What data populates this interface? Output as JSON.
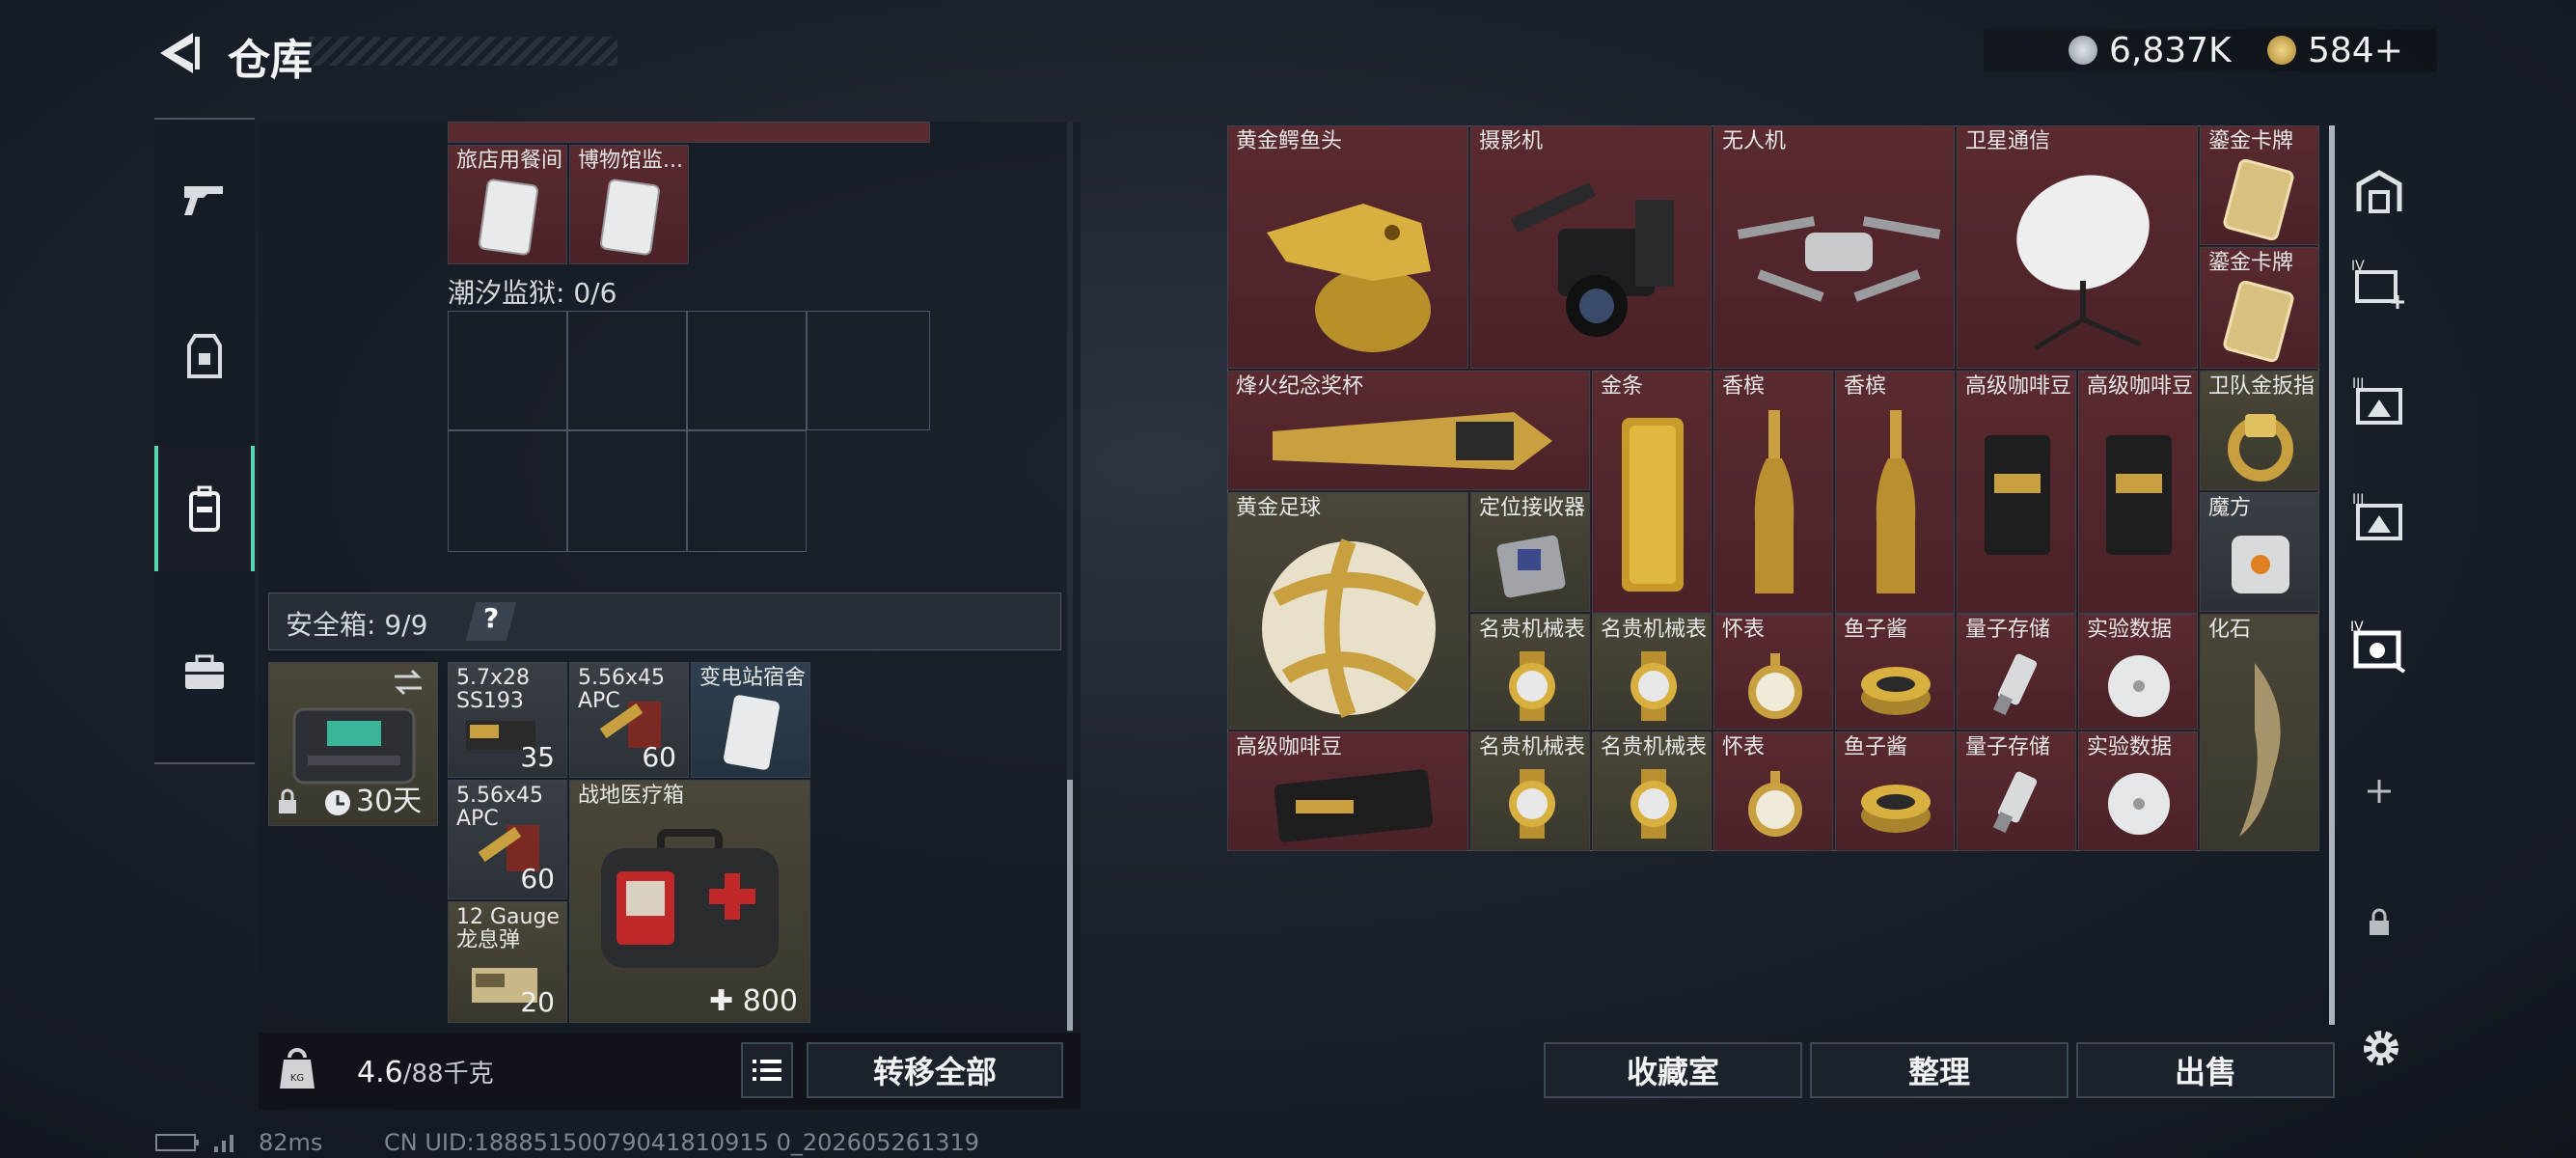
{
  "header": {
    "title": "仓库"
  },
  "currency": {
    "silver": "6,837K",
    "gold": "584+"
  },
  "left_nav": [
    "weapons-tab",
    "equipment-tab",
    "backpack-tab",
    "briefcase-tab"
  ],
  "storage": {
    "top_items": [
      {
        "label": "旅店用餐间",
        "color": "red"
      },
      {
        "label": "博物馆监...",
        "color": "red"
      }
    ],
    "tide_prison_label": "潮汐监狱: 0/6"
  },
  "safe_box": {
    "label": "安全箱: 9/9",
    "help": "?",
    "duration": "30天",
    "items": [
      {
        "label": "5.7x28 SS193",
        "count": "35"
      },
      {
        "label": "5.56x45 APC",
        "count": "60"
      },
      {
        "label": "变电站宿舍",
        "count": ""
      },
      {
        "label": "5.56x45 APC",
        "count": "60"
      },
      {
        "label": "战地医疗箱",
        "count": "800"
      },
      {
        "label": "12 Gauge 龙息弹",
        "count": "20"
      }
    ]
  },
  "weight": {
    "current": "4.6",
    "max": "/88千克"
  },
  "buttons": {
    "transfer_all": "转移全部",
    "collection": "收藏室",
    "organize": "整理",
    "sell": "出售"
  },
  "right_items": [
    {
      "label": "黄金鳄鱼头"
    },
    {
      "label": "摄影机"
    },
    {
      "label": "无人机"
    },
    {
      "label": "卫星通信"
    },
    {
      "label": "鎏金卡牌"
    },
    {
      "label": "鎏金卡牌"
    },
    {
      "label": "烽火纪念奖杯"
    },
    {
      "label": "金条"
    },
    {
      "label": "香槟"
    },
    {
      "label": "香槟"
    },
    {
      "label": "高级咖啡豆"
    },
    {
      "label": "高级咖啡豆"
    },
    {
      "label": "卫队金扳指"
    },
    {
      "label": "黄金足球"
    },
    {
      "label": "定位接收器"
    },
    {
      "label": "魔方"
    },
    {
      "label": "名贵机械表"
    },
    {
      "label": "名贵机械表"
    },
    {
      "label": "怀表"
    },
    {
      "label": "鱼子酱"
    },
    {
      "label": "量子存储"
    },
    {
      "label": "实验数据"
    },
    {
      "label": "化石"
    },
    {
      "label": "高级咖啡豆"
    },
    {
      "label": "名贵机械表"
    },
    {
      "label": "名贵机械表"
    },
    {
      "label": "怀表"
    },
    {
      "label": "鱼子酱"
    },
    {
      "label": "量子存储"
    },
    {
      "label": "实验数据"
    }
  ],
  "footer": {
    "ping": "82ms",
    "uid": "CN UID:18885150079041810915 0_202605261319"
  }
}
